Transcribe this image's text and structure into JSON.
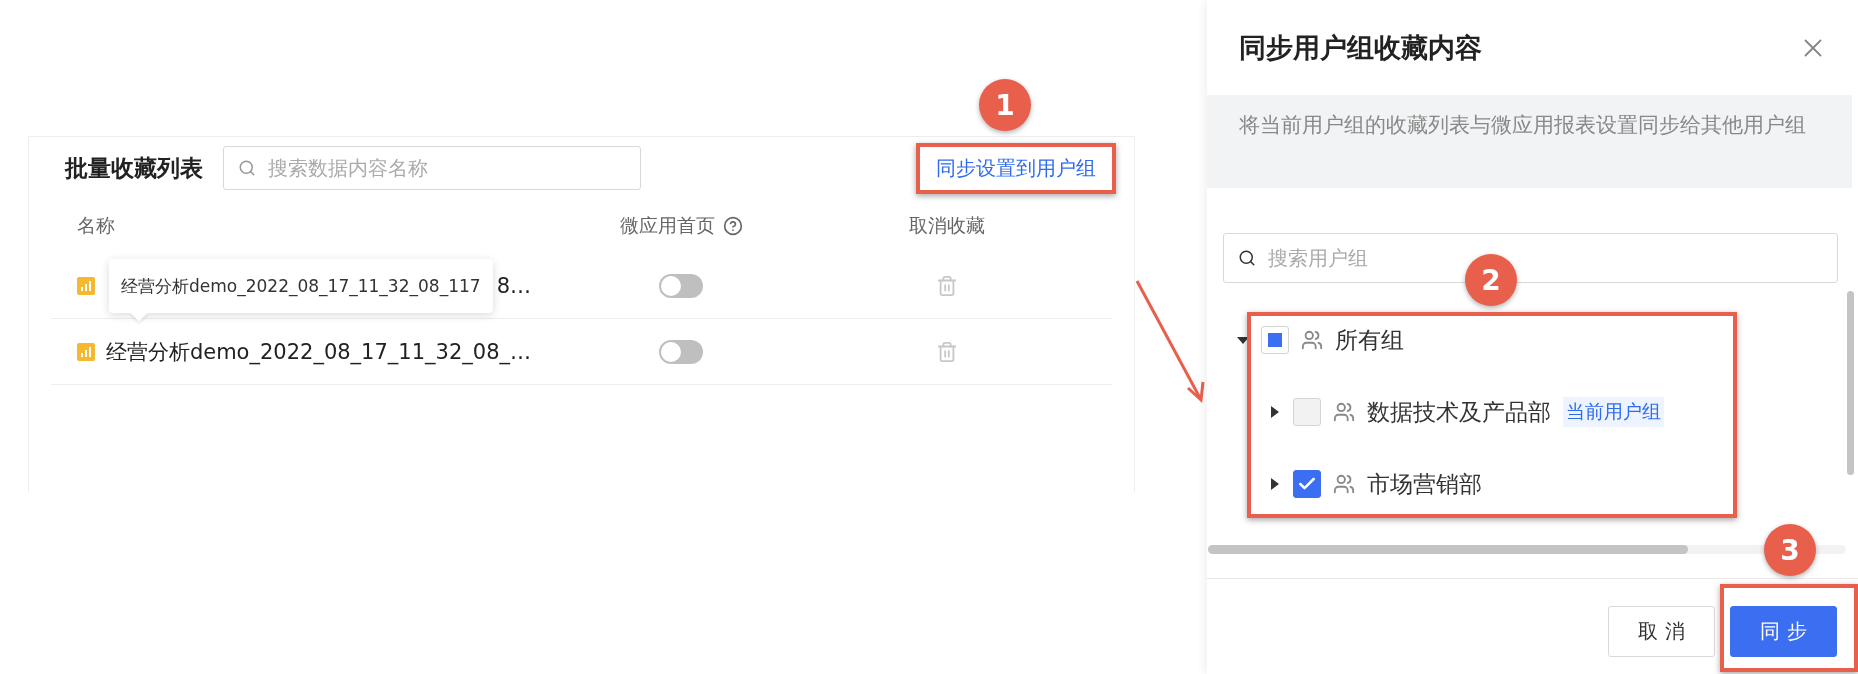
{
  "list_panel": {
    "title": "批量收藏列表",
    "search": {
      "placeholder": "搜索数据内容名称"
    },
    "sync_link": "同步设置到用户组",
    "columns": [
      {
        "label": "名称"
      },
      {
        "label": "微应用首页",
        "help": true
      },
      {
        "label": "取消收藏"
      }
    ],
    "rows": [
      {
        "name": "8…",
        "on": false
      },
      {
        "name": "经营分析demo_2022_08_17_11_32_08_…",
        "on": false
      }
    ],
    "tooltip": "经营分析demo_2022_08_17_11_32_08_117"
  },
  "drawer": {
    "title": "同步用户组收藏内容",
    "description": "将当前用户组的收藏列表与微应用报表设置同步给其他用户组",
    "search": {
      "placeholder": "搜索用户组"
    },
    "tree": [
      {
        "label": "所有组",
        "expanded": true,
        "checked": false,
        "indeterminate": true,
        "disabled": false,
        "children": [
          {
            "label": "数据技术及产品部",
            "tag": "当前用户组",
            "expanded": false,
            "checked": false,
            "indeterminate": false,
            "disabled": true
          },
          {
            "label": "市场营销部",
            "expanded": false,
            "checked": true,
            "indeterminate": false,
            "disabled": false
          }
        ]
      }
    ],
    "buttons": [
      {
        "label": "取 消",
        "primary": false
      },
      {
        "label": "同 步",
        "primary": true
      }
    ]
  },
  "callouts": [
    "1",
    "2",
    "3"
  ]
}
